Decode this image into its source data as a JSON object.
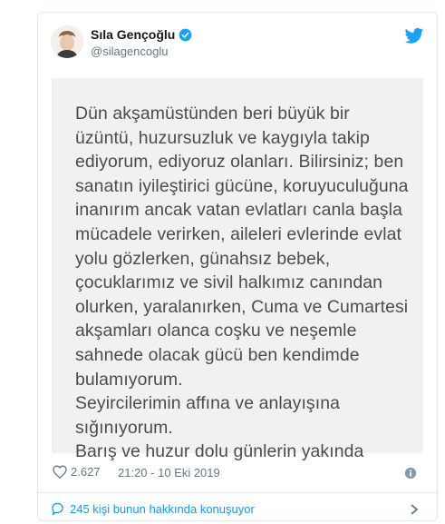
{
  "tweet": {
    "display_name": "Sıla Gençoğlu",
    "handle": "@silagencoglu",
    "text_lines": [
      "Dün akşamüstünden beri büyük bir",
      "üzüntü, huzursuzluk ve kaygıyla takip",
      "ediyorum, ediyoruz olanları. Bilirsiniz; ben",
      "sanatın iyileştirici gücüne, koruyuculuğuna",
      "inanırım ancak vatan evlatları canla başla",
      "mücadele verirken, aileleri evlerinde evlat",
      "yolu gözlerken, günahsız bebek,",
      "çocuklarımız ve sivil halkımız canından",
      "olurken, yaralanırken, Cuma ve Cumartesi",
      "akşamları olanca coşku ve neşemle",
      "sahnede olacak gücü ben kendimde",
      "bulamıyorum.",
      "Seyircilerimin affına ve anlayışına",
      "sığınıyorum.",
      "Barış ve huzur dolu günlerin yakında"
    ],
    "likes": "2.627",
    "timestamp": "21:20 - 10 Eki 2019",
    "conversation": "245 kişi bunun hakkında konuşuyor"
  },
  "icons": {
    "verified": "verified-badge-icon",
    "bird": "twitter-bird-icon",
    "heart": "heart-icon",
    "info": "info-icon",
    "comment": "comment-bubble-icon",
    "chevron": "chevron-right-icon"
  },
  "colors": {
    "accent": "#1da1f2",
    "link": "#1b95e0",
    "muted": "#657786",
    "text": "#14171a",
    "image_bg": "#f1f1f1",
    "image_text": "#4c4c4c"
  }
}
